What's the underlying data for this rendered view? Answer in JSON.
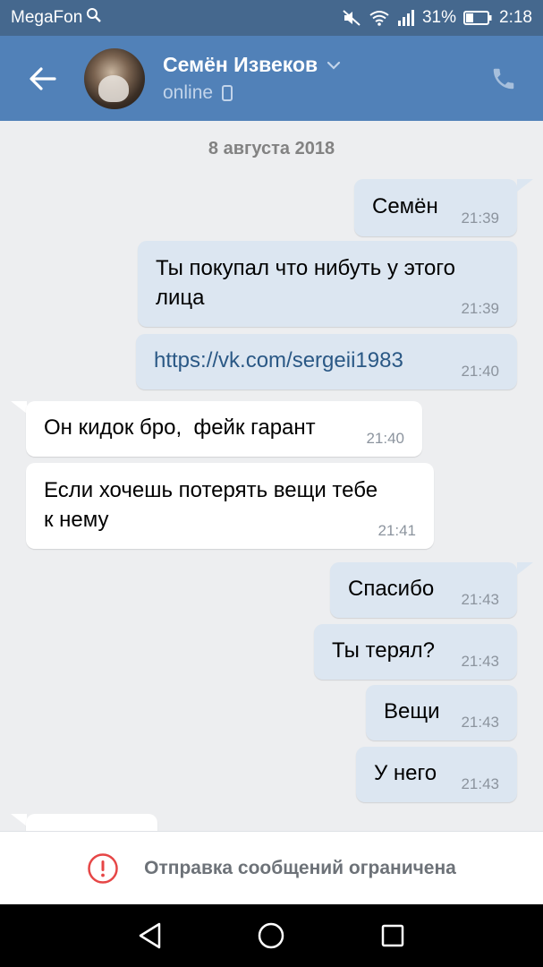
{
  "status_bar": {
    "carrier": "MegaFon",
    "battery_percent": "31%",
    "time": "2:18"
  },
  "header": {
    "contact_name": "Семён Извеков",
    "presence": "online"
  },
  "chat": {
    "date": "8 августа 2018",
    "messages": [
      {
        "direction": "out",
        "lines": [
          "Семён"
        ],
        "time": "21:39"
      },
      {
        "direction": "out",
        "lines": [
          "Ты покупал что нибуть у этого",
          "лица"
        ],
        "time": "21:39"
      },
      {
        "direction": "out",
        "lines": [
          "https://vk.com/sergeii1983"
        ],
        "time": "21:40",
        "is_link": true
      },
      {
        "direction": "in",
        "lines": [
          "Он кидок бро,  фейк гарант"
        ],
        "time": "21:40"
      },
      {
        "direction": "in",
        "lines": [
          "Если хочешь потерять вещи тебе",
          "к нему"
        ],
        "time": "21:41"
      },
      {
        "direction": "out",
        "lines": [
          "Спасибо"
        ],
        "time": "21:43"
      },
      {
        "direction": "out",
        "lines": [
          "Ты терял?"
        ],
        "time": "21:43"
      },
      {
        "direction": "out",
        "lines": [
          "Вещи"
        ],
        "time": "21:43"
      },
      {
        "direction": "out",
        "lines": [
          "У него"
        ],
        "time": "21:43"
      }
    ]
  },
  "restriction": {
    "text": "Отправка сообщений ограничена",
    "icon": "warning-circle-icon",
    "color": "#e64646"
  },
  "colors": {
    "header_bg": "#5181b8",
    "status_bg": "#45688e",
    "outgoing_bubble": "#dce6f1",
    "incoming_bubble": "#ffffff",
    "chat_bg": "#edeef0"
  }
}
